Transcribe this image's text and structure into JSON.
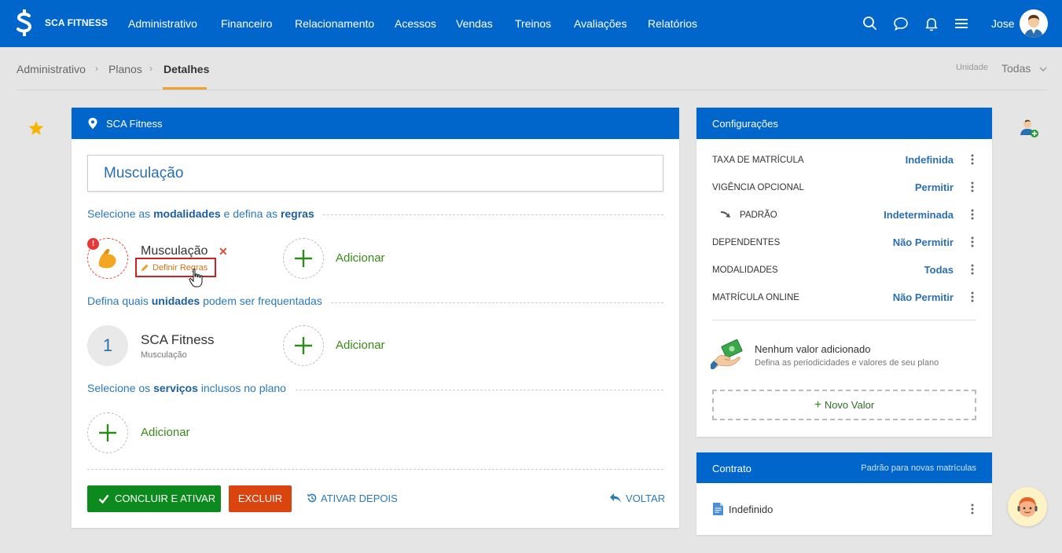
{
  "brand": {
    "name": "SCA FITNESS"
  },
  "nav": {
    "items": [
      "Administrativo",
      "Financeiro",
      "Relacionamento",
      "Acessos",
      "Vendas",
      "Treinos",
      "Avaliações",
      "Relatórios"
    ],
    "user": "Jose"
  },
  "breadcrumb": [
    "Administrativo",
    "Planos",
    "Detalhes"
  ],
  "unit_filter": {
    "label": "Unidade",
    "value": "Todas"
  },
  "plan": {
    "location": "SCA Fitness",
    "name": "Musculação",
    "sections": {
      "modalities": {
        "pre": "Selecione as ",
        "strong1": "modalidades",
        "mid": " e defina as ",
        "strong2": "regras"
      },
      "units": {
        "pre": "Defina quais ",
        "strong": "unidades",
        "post": " podem ser frequentadas"
      },
      "services": {
        "pre": "Selecione os ",
        "strong": "serviços",
        "post": " inclusos no plano"
      }
    },
    "modality": {
      "name": "Musculação",
      "define_rules": "Definir Regras",
      "alert": "!"
    },
    "unit": {
      "number": "1",
      "name": "SCA Fitness",
      "sub": "Musculação"
    },
    "add_label": "Adicionar",
    "actions": {
      "conclude": "CONCLUIR E ATIVAR",
      "delete": "EXCLUIR",
      "activate_later": "ATIVAR DEPOIS",
      "back": "VOLTAR"
    }
  },
  "config": {
    "title": "Configurações",
    "rows": [
      {
        "label": "TAXA DE MATRÍCULA",
        "value": "Indefinida"
      },
      {
        "label": "VIGÊNCIA OPCIONAL",
        "value": "Permitir"
      },
      {
        "label": "PADRÃO",
        "value": "Indeterminada"
      },
      {
        "label": "DEPENDENTES",
        "value": "Não Permitir"
      },
      {
        "label": "MODALIDADES",
        "value": "Todas"
      },
      {
        "label": "MATRÍCULA ONLINE",
        "value": "Não Permitir"
      }
    ],
    "empty_title": "Nenhum valor adicionado",
    "empty_sub": "Defina as periodicidades e valores de seu plano",
    "new_value": "Novo Valor"
  },
  "contract": {
    "title": "Contrato",
    "sub": "Padrão para novas matrículas",
    "value": "Indefinido"
  },
  "colors": {
    "primary": "#0066cc",
    "success": "#0d8a1e",
    "danger": "#d9440f",
    "accent": "#f0a030"
  }
}
